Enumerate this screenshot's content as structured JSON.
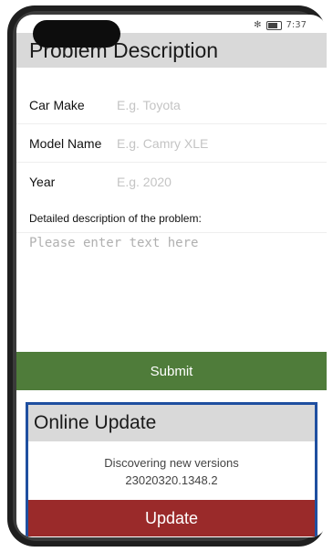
{
  "status_bar": {
    "left_text": "· · · ·",
    "bluetooth": "✻",
    "time": "7:37"
  },
  "problem": {
    "title": "Problem Description",
    "car_make": {
      "label": "Car Make",
      "placeholder": "E.g. Toyota",
      "value": ""
    },
    "model_name": {
      "label": "Model Name",
      "placeholder": "E.g. Camry XLE",
      "value": ""
    },
    "year": {
      "label": "Year",
      "placeholder": "E.g. 2020",
      "value": ""
    },
    "detail_label": "Detailed description of the problem:",
    "detail_placeholder": "Please enter text here",
    "submit_label": "Submit"
  },
  "online_update": {
    "title": "Online Update",
    "status_text": "Discovering new versions",
    "version": "23020320.1348.2",
    "button_label": "Update"
  },
  "colors": {
    "submit": "#4f7c3a",
    "update_button": "#9a2a2a",
    "panel_border": "#1f4fa0",
    "header_bg": "#d9d9d9"
  }
}
